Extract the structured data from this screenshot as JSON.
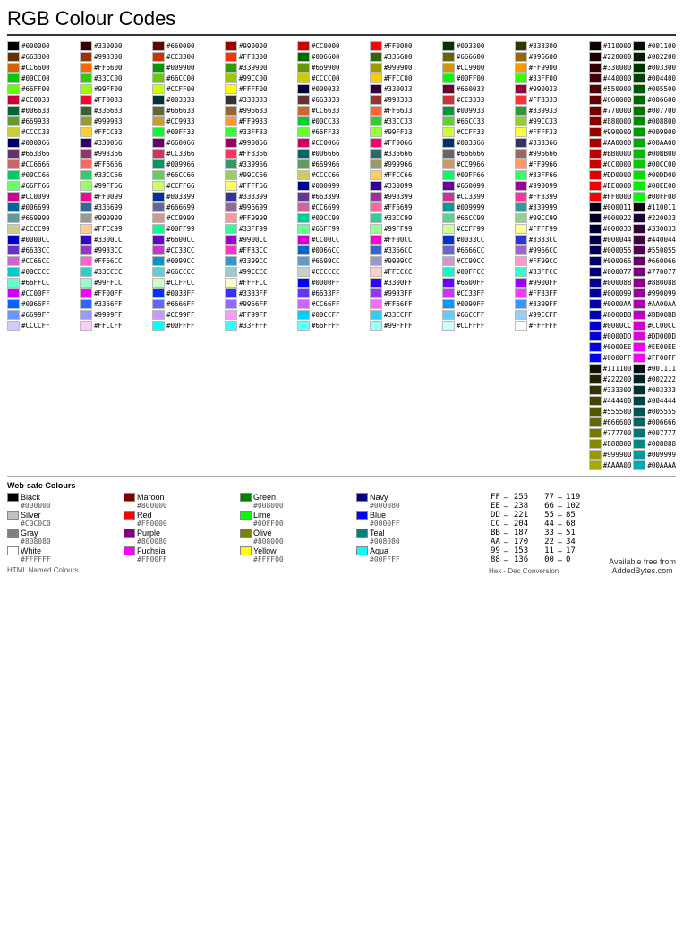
{
  "title": "RGB Colour Codes",
  "colors": [
    {
      "hex": "#000000",
      "bg": "#000000"
    },
    {
      "hex": "#330000",
      "bg": "#330000"
    },
    {
      "hex": "#660000",
      "bg": "#660000"
    },
    {
      "hex": "#990000",
      "bg": "#990000"
    },
    {
      "hex": "#CC0000",
      "bg": "#CC0000"
    },
    {
      "hex": "#FF0000",
      "bg": "#FF0000"
    },
    {
      "hex": "#110000",
      "bg": "#110000"
    },
    {
      "hex": "#001100",
      "bg": "#001100"
    },
    {
      "hex": "#003300",
      "bg": "#003300"
    },
    {
      "hex": "#333300",
      "bg": "#333300"
    },
    {
      "hex": "#663300",
      "bg": "#663300"
    },
    {
      "hex": "#993300",
      "bg": "#993300"
    },
    {
      "hex": "#CC3300",
      "bg": "#CC3300"
    },
    {
      "hex": "#FF3300",
      "bg": "#FF3300"
    },
    {
      "hex": "#220000",
      "bg": "#220000"
    },
    {
      "hex": "#002200",
      "bg": "#002200"
    },
    {
      "hex": "#006600",
      "bg": "#006600"
    },
    {
      "hex": "#336600",
      "bg": "#336600"
    },
    {
      "hex": "#666600",
      "bg": "#666600"
    },
    {
      "hex": "#996600",
      "bg": "#996600"
    },
    {
      "hex": "#CC6600",
      "bg": "#CC6600"
    },
    {
      "hex": "#FF6600",
      "bg": "#FF6600"
    },
    {
      "hex": "#330000",
      "bg": "#330000"
    },
    {
      "hex": "#003300",
      "bg": "#003300"
    },
    {
      "hex": "#009900",
      "bg": "#009900"
    },
    {
      "hex": "#339900",
      "bg": "#339900"
    },
    {
      "hex": "#669900",
      "bg": "#669900"
    },
    {
      "hex": "#999900",
      "bg": "#999900"
    },
    {
      "hex": "#CC9900",
      "bg": "#CC9900"
    },
    {
      "hex": "#FF9900",
      "bg": "#FF9900"
    },
    {
      "hex": "#440000",
      "bg": "#440000"
    },
    {
      "hex": "#004400",
      "bg": "#004400"
    },
    {
      "hex": "#00CC00",
      "bg": "#00CC00"
    },
    {
      "hex": "#33CC00",
      "bg": "#33CC00"
    },
    {
      "hex": "#66CC00",
      "bg": "#66CC00"
    },
    {
      "hex": "#99CC00",
      "bg": "#99CC00"
    },
    {
      "hex": "#CCCC00",
      "bg": "#CCCC00"
    },
    {
      "hex": "#FFCC00",
      "bg": "#FFCC00"
    },
    {
      "hex": "#550000",
      "bg": "#550000"
    },
    {
      "hex": "#005500",
      "bg": "#005500"
    },
    {
      "hex": "#00FF00",
      "bg": "#00FF00"
    },
    {
      "hex": "#33FF00",
      "bg": "#33FF00"
    },
    {
      "hex": "#66FF00",
      "bg": "#66FF00"
    },
    {
      "hex": "#99FF00",
      "bg": "#99FF00"
    },
    {
      "hex": "#CCFF00",
      "bg": "#CCFF00"
    },
    {
      "hex": "#FFFF00",
      "bg": "#FFFF00"
    },
    {
      "hex": "#660000",
      "bg": "#660000"
    },
    {
      "hex": "#006600",
      "bg": "#006600"
    }
  ],
  "websafe_label": "Web-safe Colours",
  "named_colors_label": "HTML Named Colours",
  "hex_dec_label": "Hex - Dec Conversion",
  "available_text": "Available free from\nAddedBytes.com",
  "named_colors": [
    {
      "name": "Black",
      "color": "#000000",
      "hex": "#000000"
    },
    {
      "name": "Maroon",
      "color": "#800000",
      "hex": "#800000"
    },
    {
      "name": "Green",
      "color": "#008000",
      "hex": "#008000"
    },
    {
      "name": "Navy",
      "color": "#000080",
      "hex": "#000080"
    },
    {
      "name": "Silver",
      "color": "#C0C0C0",
      "hex": "#C0C0C0"
    },
    {
      "name": "Red",
      "color": "#FF0000",
      "hex": "#FF0000"
    },
    {
      "name": "Lime",
      "color": "#00FF00",
      "hex": "#00FF00"
    },
    {
      "name": "Blue",
      "color": "#0000FF",
      "hex": "#0000FF"
    },
    {
      "name": "Gray",
      "color": "#808080",
      "hex": "#808080"
    },
    {
      "name": "Purple",
      "color": "#800080",
      "hex": "#800080"
    },
    {
      "name": "Olive",
      "color": "#808000",
      "hex": "#808000"
    },
    {
      "name": "Teal",
      "color": "#008080",
      "hex": "#008080"
    },
    {
      "name": "White",
      "color": "#FFFFFF",
      "hex": "#FFFFFF"
    },
    {
      "name": "Fuchsia",
      "color": "#FF00FF",
      "hex": "#FF00FF"
    },
    {
      "name": "Yellow",
      "color": "#FFFF00",
      "hex": "#FFFF00"
    },
    {
      "name": "Aqua",
      "color": "#00FFFF",
      "hex": "#00FFFF"
    }
  ],
  "hex_dec": [
    {
      "hex": "FF",
      "dec": "255",
      "hex2": "77",
      "dec2": "119"
    },
    {
      "hex": "EE",
      "dec": "238",
      "hex2": "66",
      "dec2": "102"
    },
    {
      "hex": "DD",
      "dec": "221",
      "hex2": "55",
      "dec2": "85"
    },
    {
      "hex": "CC",
      "dec": "204",
      "hex2": "44",
      "dec2": "68"
    },
    {
      "hex": "BB",
      "dec": "187",
      "hex2": "33",
      "dec2": "51"
    },
    {
      "hex": "AA",
      "dec": "170",
      "hex2": "22",
      "dec2": "34"
    },
    {
      "hex": "99",
      "dec": "153",
      "hex2": "11",
      "dec2": "17"
    },
    {
      "hex": "88",
      "dec": "136",
      "hex2": "00",
      "dec2": "0"
    }
  ]
}
